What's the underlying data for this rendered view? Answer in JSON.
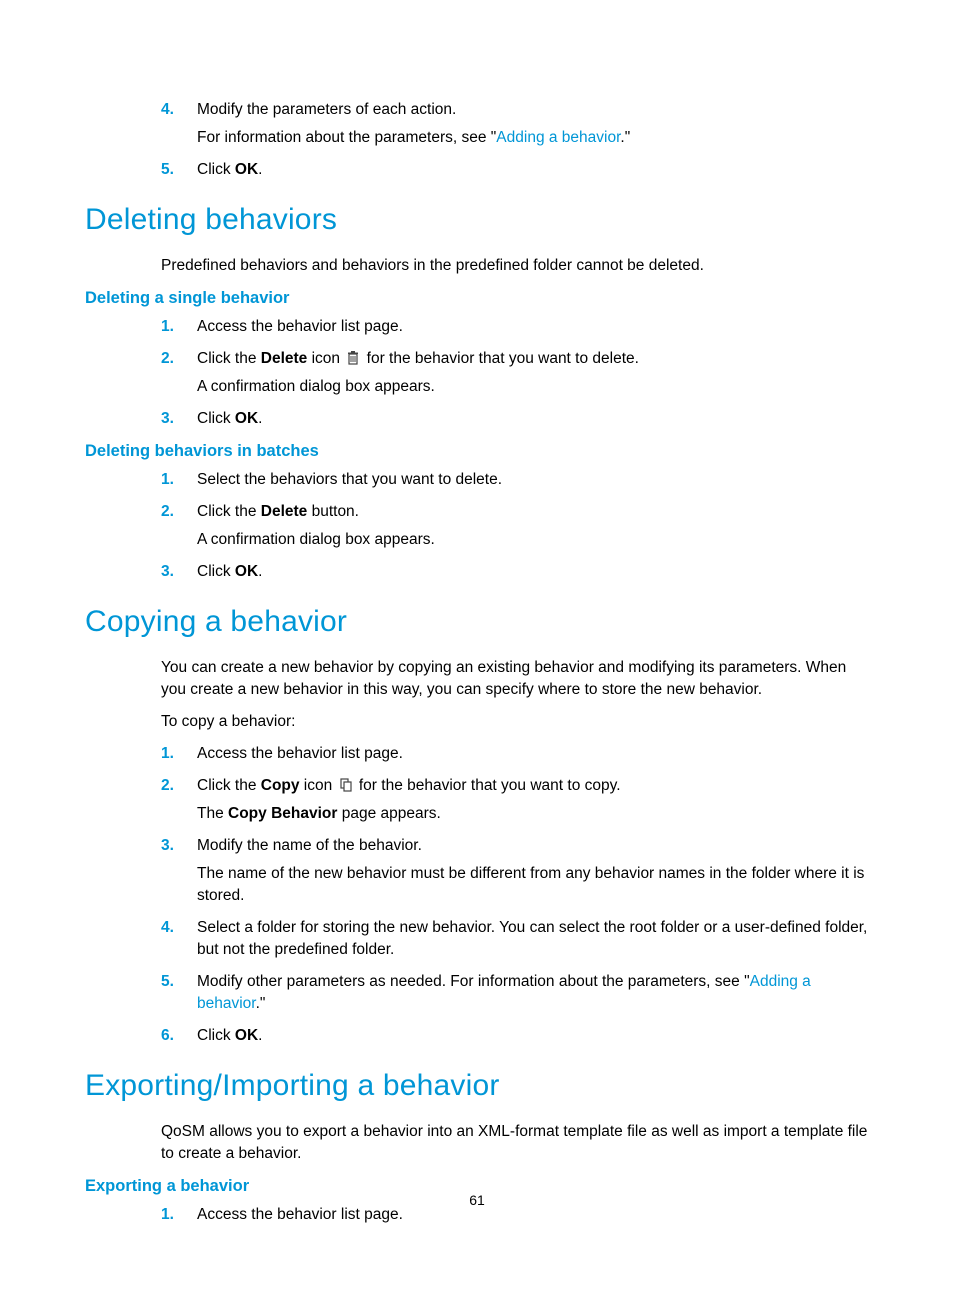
{
  "pageNumber": "61",
  "intro": {
    "step4a": "Modify the parameters of each action.",
    "step4b_pre": "For information about the parameters, see \"",
    "step4b_link": "Adding a behavior",
    "step4b_post": ".\"",
    "step5_pre": "Click ",
    "step5_bold": "OK",
    "step5_post": "."
  },
  "deleting": {
    "heading": "Deleting behaviors",
    "intro": "Predefined behaviors and behaviors in the predefined folder cannot be deleted.",
    "single": {
      "heading": "Deleting a single behavior",
      "s1": "Access the behavior list page.",
      "s2_pre": "Click the ",
      "s2_bold": "Delete",
      "s2_mid": " icon ",
      "s2_post": " for the behavior that you want to delete.",
      "s2_sub": "A confirmation dialog box appears.",
      "s3_pre": "Click ",
      "s3_bold": "OK",
      "s3_post": "."
    },
    "batch": {
      "heading": "Deleting behaviors in batches",
      "s1": "Select the behaviors that you want to delete.",
      "s2_pre": "Click the ",
      "s2_bold": "Delete",
      "s2_post": " button.",
      "s2_sub": "A confirmation dialog box appears.",
      "s3_pre": "Click ",
      "s3_bold": "OK",
      "s3_post": "."
    }
  },
  "copying": {
    "heading": "Copying a behavior",
    "p1": "You can create a new behavior by copying an existing behavior and modifying its parameters. When you create a new behavior in this way, you can specify where to store the new behavior.",
    "p2": "To copy a behavior:",
    "s1": "Access the behavior list page.",
    "s2_pre": "Click the ",
    "s2_bold": "Copy",
    "s2_mid": " icon ",
    "s2_post": " for the behavior that you want to copy.",
    "s2_sub_pre": "The ",
    "s2_sub_bold": "Copy Behavior",
    "s2_sub_post": " page appears.",
    "s3": "Modify the name of the behavior.",
    "s3_sub": "The name of the new behavior must be different from any behavior names in the folder where it is stored.",
    "s4": "Select a folder for storing the new behavior. You can select the root folder or a user-defined folder, but not the predefined folder.",
    "s5_pre": "Modify other parameters as needed. For information about the parameters, see \"",
    "s5_link": "Adding a behavior",
    "s5_post": ".\"",
    "s6_pre": "Click ",
    "s6_bold": "OK",
    "s6_post": "."
  },
  "exporting": {
    "heading": "Exporting/Importing a behavior",
    "intro": "QoSM allows you to export a behavior into an XML-format template file as well as import a template file to create a behavior.",
    "sub": {
      "heading": "Exporting a behavior",
      "s1": "Access the behavior list page."
    }
  },
  "markers": {
    "n1": "1.",
    "n2": "2.",
    "n3": "3.",
    "n4": "4.",
    "n5": "5.",
    "n6": "6."
  }
}
